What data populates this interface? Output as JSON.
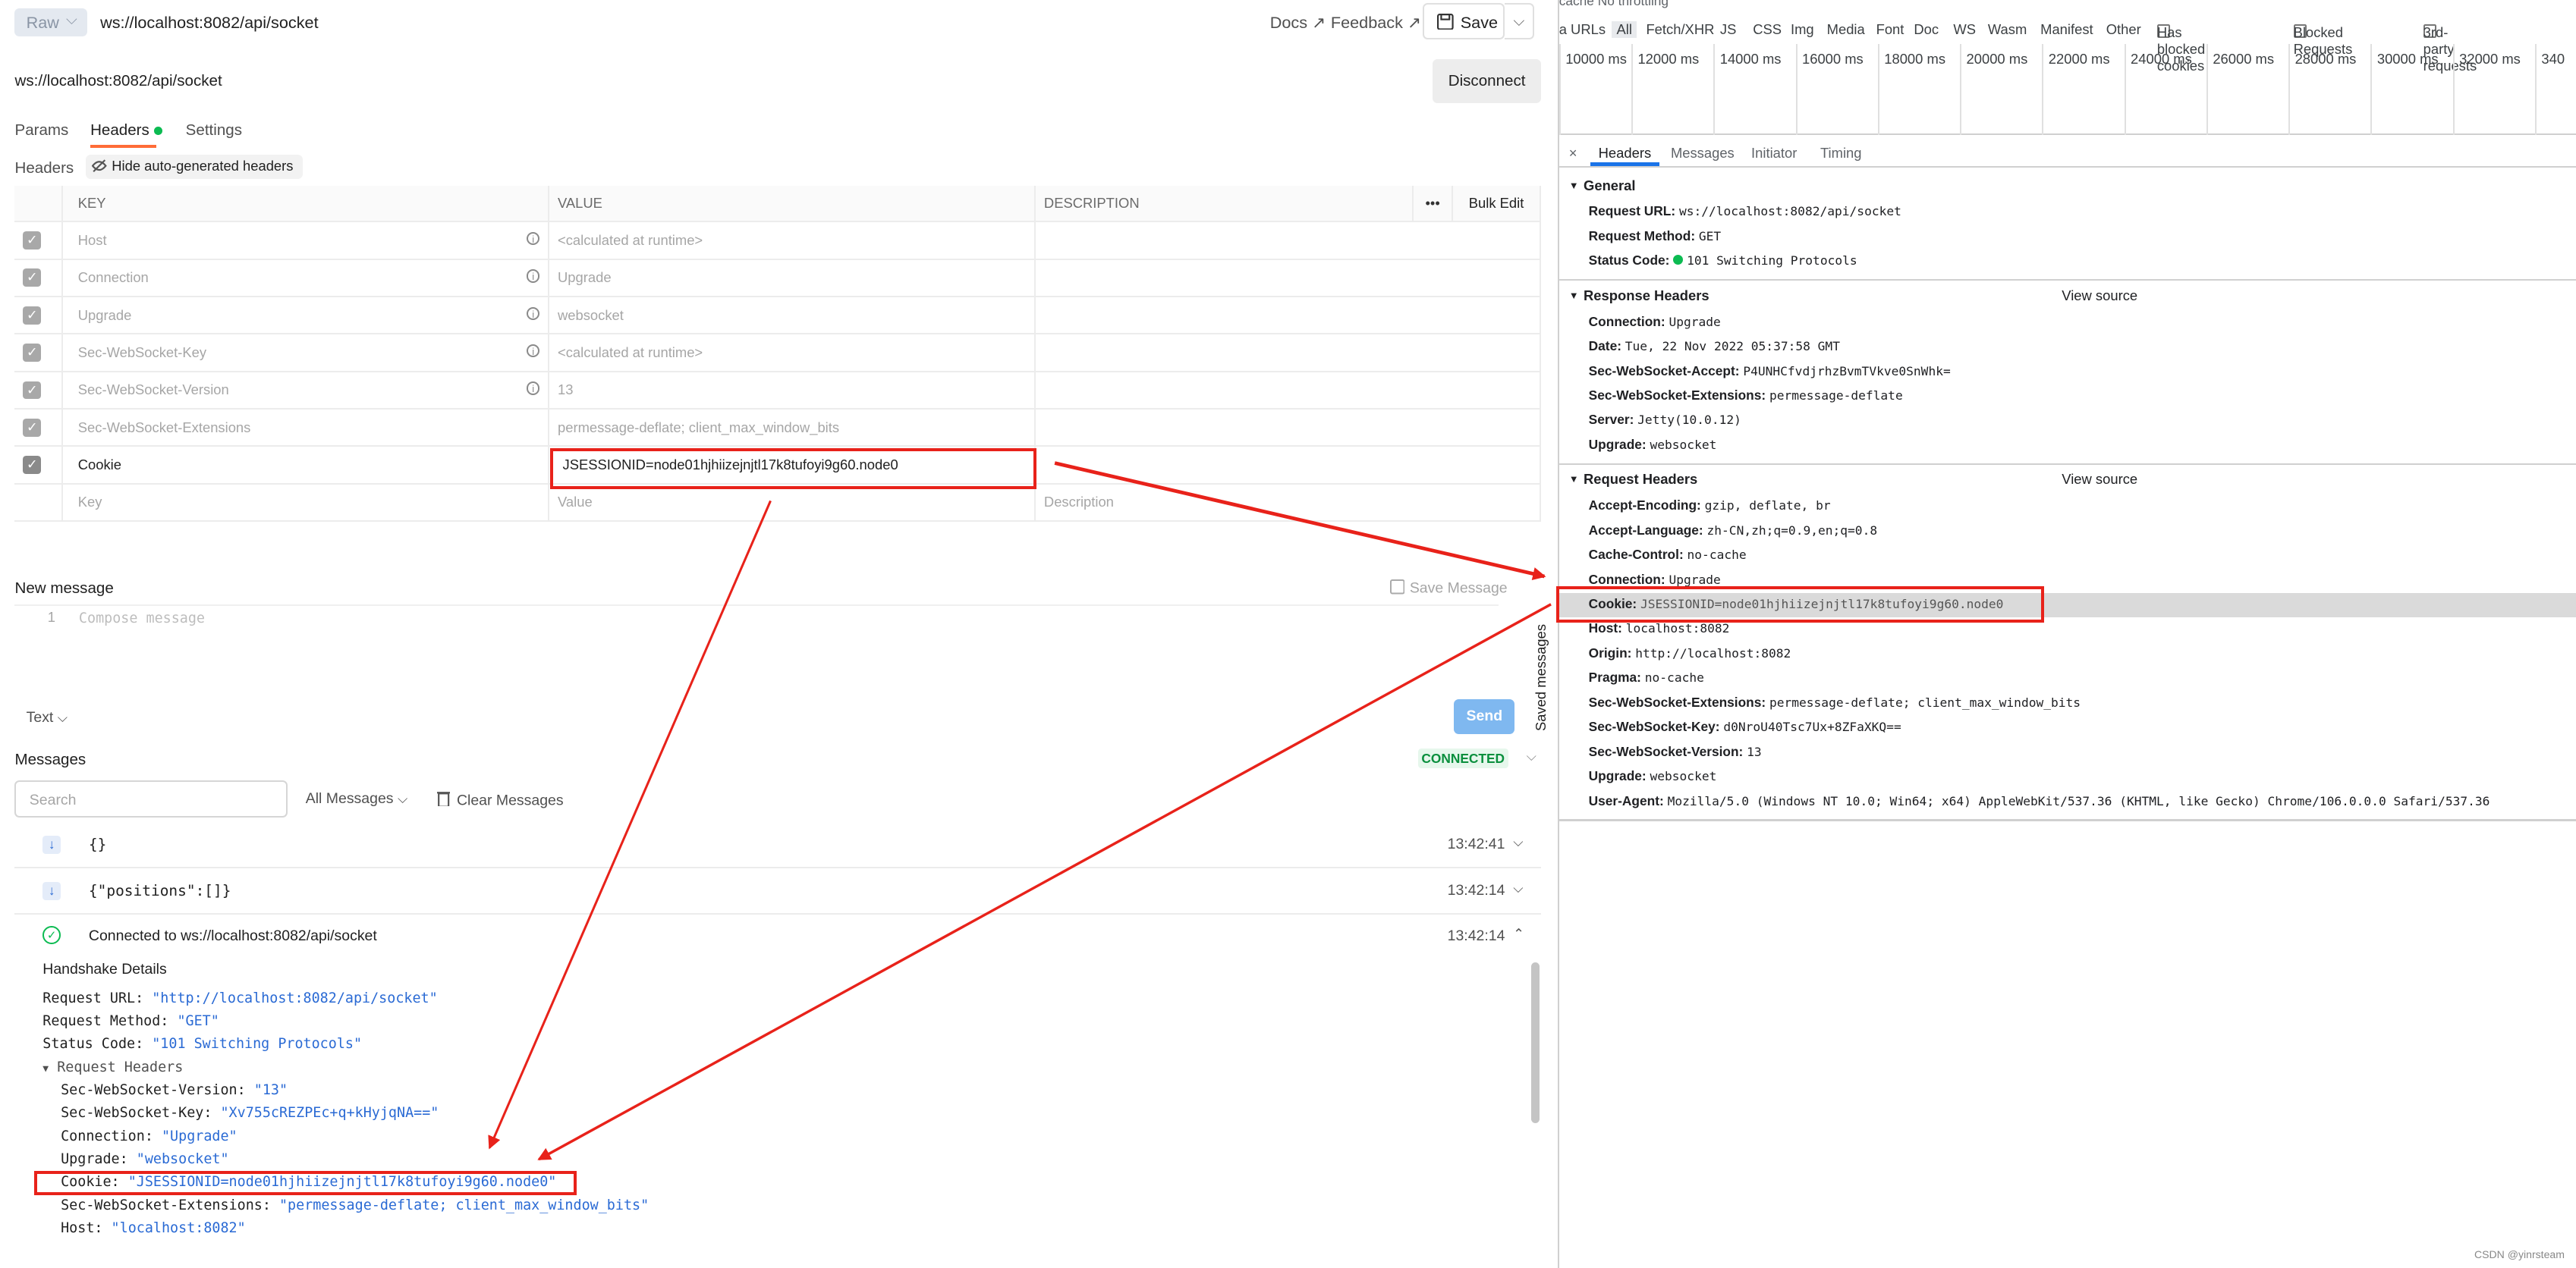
{
  "left": {
    "toolbar": {
      "raw_label": "Raw",
      "url": "ws://localhost:8082/api/socket",
      "docs": "Docs ↗",
      "feedback": "Feedback ↗",
      "save": "Save"
    },
    "request_url": "ws://localhost:8082/api/socket",
    "disconnect": "Disconnect",
    "tabs": [
      "Params",
      "Headers",
      "Settings"
    ],
    "headers_label": "Headers",
    "hide_auto": "Hide auto-generated headers",
    "table": {
      "columns": [
        "KEY",
        "VALUE",
        "DESCRIPTION"
      ],
      "more": "•••",
      "bulk_edit": "Bulk Edit",
      "rows": [
        {
          "key": "Host",
          "value": "<calculated at runtime>"
        },
        {
          "key": "Connection",
          "value": "Upgrade"
        },
        {
          "key": "Upgrade",
          "value": "websocket"
        },
        {
          "key": "Sec-WebSocket-Key",
          "value": "<calculated at runtime>"
        },
        {
          "key": "Sec-WebSocket-Version",
          "value": "13"
        },
        {
          "key": "Sec-WebSocket-Extensions",
          "value": "permessage-deflate; client_max_window_bits"
        },
        {
          "key": "Cookie",
          "value": "JSESSIONID=node01hjhiizejnjtl17k8tufoyi9g60.node0"
        }
      ],
      "placeholder": {
        "key": "Key",
        "value": "Value",
        "description": "Description"
      }
    },
    "new_message": "New message",
    "save_message": "Save Message",
    "line_number": "1",
    "compose_placeholder": "Compose message",
    "text_format": "Text",
    "send": "Send",
    "saved_messages": "Saved messages",
    "messages_label": "Messages",
    "status": "CONNECTED",
    "search_placeholder": "Search",
    "filter": "All Messages",
    "clear": "Clear Messages",
    "messages": [
      {
        "text": "{}",
        "time": "13:42:41"
      },
      {
        "text": "{\"positions\":[]}",
        "time": "13:42:14"
      },
      {
        "text": "Connected to ws://localhost:8082/api/socket",
        "time": "13:42:14"
      }
    ],
    "handshake": {
      "title": "Handshake Details",
      "lines": [
        {
          "k": "Request URL: ",
          "v": "\"http://localhost:8082/api/socket\""
        },
        {
          "k": "Request Method: ",
          "v": "\"GET\""
        },
        {
          "k": "Status Code: ",
          "v": "\"101 Switching Protocols\""
        }
      ],
      "req_headers_title": "Request Headers",
      "req_headers": [
        {
          "k": "Sec-WebSocket-Version: ",
          "v": "\"13\""
        },
        {
          "k": "Sec-WebSocket-Key: ",
          "v": "\"Xv755cREZPEc+q+kHyjqNA==\""
        },
        {
          "k": "Connection: ",
          "v": "\"Upgrade\""
        },
        {
          "k": "Upgrade: ",
          "v": "\"websocket\""
        },
        {
          "k": "Cookie: ",
          "v": "\"JSESSIONID=node01hjhiizejnjtl17k8tufoyi9g60.node0\""
        },
        {
          "k": "Sec-WebSocket-Extensions: ",
          "v": "\"permessage-deflate; client_max_window_bits\""
        },
        {
          "k": "Host: ",
          "v": "\"localhost:8082\""
        }
      ]
    }
  },
  "right": {
    "topbar": "cache    No throttling",
    "filters": [
      "a URLs",
      "All",
      "Fetch/XHR",
      "JS",
      "CSS",
      "Img",
      "Media",
      "Font",
      "Doc",
      "WS",
      "Wasm",
      "Manifest",
      "Other"
    ],
    "checks": [
      "Has blocked cookies",
      "Blocked Requests",
      "3rd-party requests"
    ],
    "ticks": [
      "10000 ms",
      "12000 ms",
      "14000 ms",
      "16000 ms",
      "18000 ms",
      "20000 ms",
      "22000 ms",
      "24000 ms",
      "26000 ms",
      "28000 ms",
      "30000 ms",
      "32000 ms",
      "340"
    ],
    "close": "×",
    "tabs": [
      "Headers",
      "Messages",
      "Initiator",
      "Timing"
    ],
    "general": {
      "title": "General",
      "items": [
        {
          "k": "Request URL:",
          "v": "ws://localhost:8082/api/socket"
        },
        {
          "k": "Request Method:",
          "v": "GET"
        },
        {
          "k": "Status Code:",
          "v": "101 Switching Protocols"
        }
      ]
    },
    "response": {
      "title": "Response Headers",
      "view_source": "View source",
      "items": [
        {
          "k": "Connection:",
          "v": "Upgrade"
        },
        {
          "k": "Date:",
          "v": "Tue, 22 Nov 2022 05:37:58 GMT"
        },
        {
          "k": "Sec-WebSocket-Accept:",
          "v": "P4UNHCfvdjrhzBvmTVkve0SnWhk="
        },
        {
          "k": "Sec-WebSocket-Extensions:",
          "v": "permessage-deflate"
        },
        {
          "k": "Server:",
          "v": "Jetty(10.0.12)"
        },
        {
          "k": "Upgrade:",
          "v": "websocket"
        }
      ]
    },
    "request": {
      "title": "Request Headers",
      "view_source": "View source",
      "items": [
        {
          "k": "Accept-Encoding:",
          "v": "gzip, deflate, br"
        },
        {
          "k": "Accept-Language:",
          "v": "zh-CN,zh;q=0.9,en;q=0.8"
        },
        {
          "k": "Cache-Control:",
          "v": "no-cache"
        },
        {
          "k": "Connection:",
          "v": "Upgrade"
        },
        {
          "k": "Cookie:",
          "v": "JSESSIONID=node01hjhiizejnjtl17k8tufoyi9g60.node0"
        },
        {
          "k": "Host:",
          "v": "localhost:8082"
        },
        {
          "k": "Origin:",
          "v": "http://localhost:8082"
        },
        {
          "k": "Pragma:",
          "v": "no-cache"
        },
        {
          "k": "Sec-WebSocket-Extensions:",
          "v": "permessage-deflate; client_max_window_bits"
        },
        {
          "k": "Sec-WebSocket-Key:",
          "v": "d0NroU40Tsc7Ux+8ZFaXKQ=="
        },
        {
          "k": "Sec-WebSocket-Version:",
          "v": "13"
        },
        {
          "k": "Upgrade:",
          "v": "websocket"
        },
        {
          "k": "User-Agent:",
          "v": "Mozilla/5.0 (Windows NT 10.0; Win64; x64) AppleWebKit/537.36 (KHTML, like Gecko) Chrome/106.0.0.0 Safari/537.36"
        }
      ]
    },
    "watermark": "CSDN @yinrsteam"
  },
  "colors": {
    "annotation": "#e8221a",
    "accent": "#ff6c37",
    "connected": "#0a8f3d",
    "send": "#7fb8f0"
  }
}
